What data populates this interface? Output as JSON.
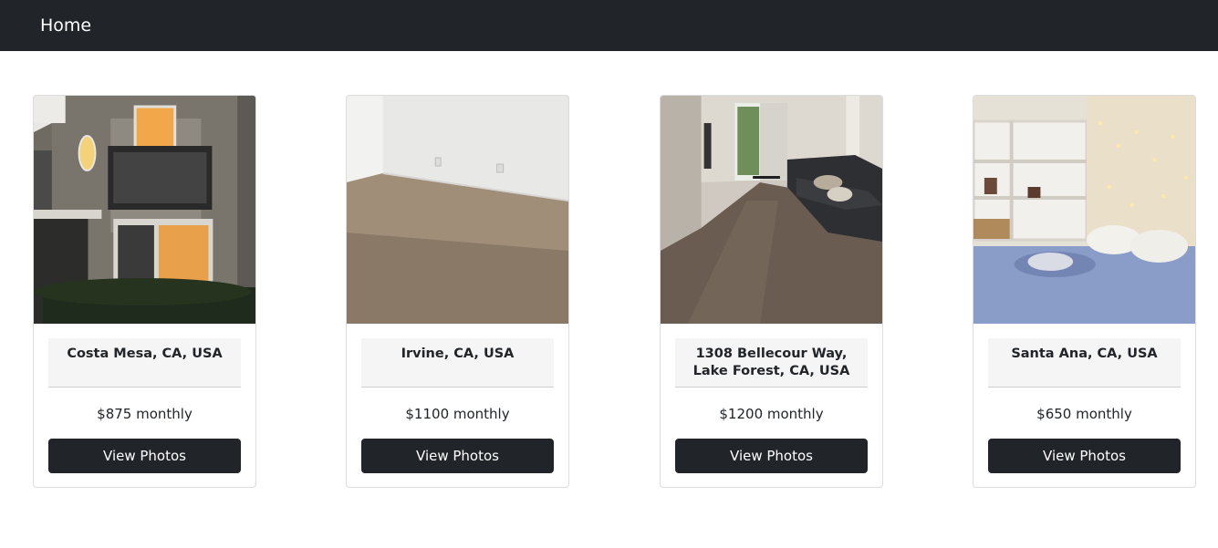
{
  "navbar": {
    "home_label": "Home"
  },
  "listings": [
    {
      "location": "Costa Mesa, CA, USA",
      "price": "$875 monthly",
      "button_label": "View Photos",
      "photo": "house-exterior-photo"
    },
    {
      "location": "Irvine, CA, USA",
      "price": "$1100 monthly",
      "button_label": "View Photos",
      "photo": "carpeted-room-photo"
    },
    {
      "location": "1308 Bellecour Way, Lake Forest, CA, USA",
      "price": "$1200 monthly",
      "button_label": "View Photos",
      "photo": "living-room-photo"
    },
    {
      "location": "Santa Ana, CA, USA",
      "price": "$650 monthly",
      "button_label": "View Photos",
      "photo": "bedroom-photo"
    }
  ]
}
